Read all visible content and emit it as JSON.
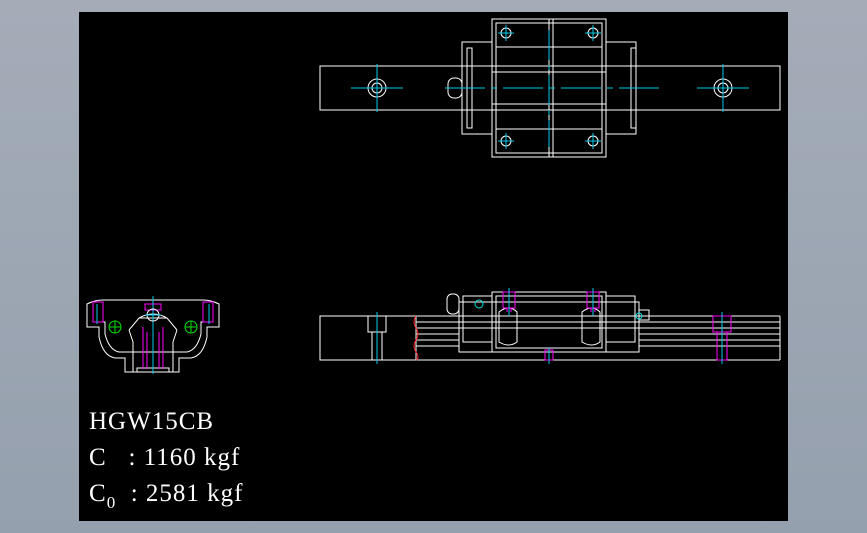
{
  "drawing": {
    "model": "HGW15CB",
    "load_dynamic": {
      "symbol": "C",
      "separator": ": ",
      "value": "1160",
      "unit": "kgf"
    },
    "load_static": {
      "symbol": "C",
      "subscript": "0",
      "separator": ": ",
      "value": "2581",
      "unit": "kgf"
    }
  },
  "colors": {
    "background": "#000000",
    "outline": "#ffffff",
    "centerline": "#00c8e8",
    "hidden": "#ff00ff",
    "section": "#ff2020",
    "ball": "#00e000"
  }
}
